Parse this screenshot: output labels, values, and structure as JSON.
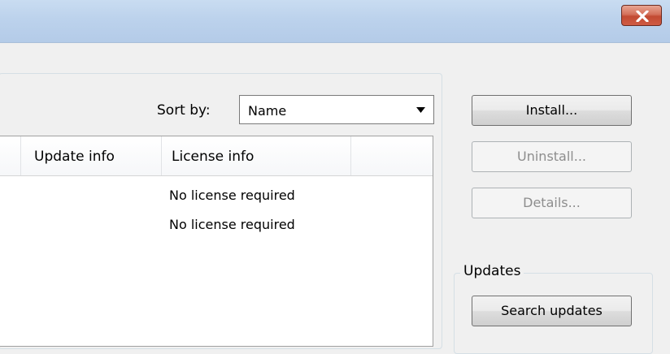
{
  "window": {
    "close_icon": "close-icon"
  },
  "sort": {
    "label": "Sort by:",
    "selected": "Name"
  },
  "list": {
    "columns": [
      "Update info",
      "License info"
    ],
    "rows": [
      {
        "license": "No license required"
      },
      {
        "license": "No license required"
      }
    ]
  },
  "buttons": {
    "install": "Install...",
    "uninstall": "Uninstall...",
    "details": "Details..."
  },
  "updates": {
    "group_label": "Updates",
    "search_button": "Search updates"
  },
  "colors": {
    "titlebar": "#bcd2ec",
    "close_button": "#c24a32",
    "background": "#f0f0f0"
  }
}
